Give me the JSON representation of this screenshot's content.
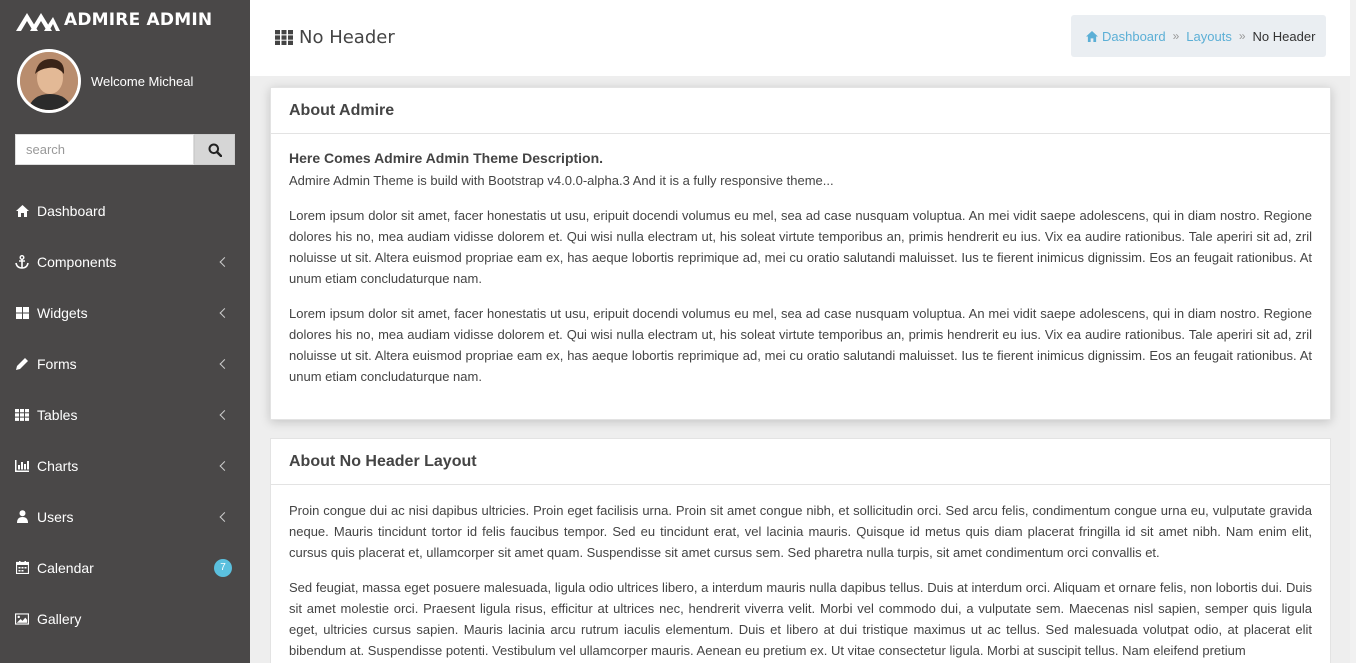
{
  "brand": {
    "name": "ADMIRE ADMIN"
  },
  "profile": {
    "welcome": "Welcome Micheal"
  },
  "search": {
    "placeholder": "search"
  },
  "nav": [
    {
      "label": "Dashboard",
      "icon": "home-icon",
      "submenu": false
    },
    {
      "label": "Components",
      "icon": "anchor-icon",
      "submenu": true
    },
    {
      "label": "Widgets",
      "icon": "th-large-icon",
      "submenu": true
    },
    {
      "label": "Forms",
      "icon": "pencil-icon",
      "submenu": true
    },
    {
      "label": "Tables",
      "icon": "table-icon",
      "submenu": true
    },
    {
      "label": "Charts",
      "icon": "bar-chart-icon",
      "submenu": true
    },
    {
      "label": "Users",
      "icon": "user-icon",
      "submenu": true
    },
    {
      "label": "Calendar",
      "icon": "calendar-icon",
      "submenu": false,
      "badge": "7"
    },
    {
      "label": "Gallery",
      "icon": "image-icon",
      "submenu": false
    }
  ],
  "header": {
    "title": "No Header",
    "breadcrumb": [
      "Dashboard",
      "Layouts",
      "No Header"
    ]
  },
  "card1": {
    "title": "About Admire",
    "subtitle": "Here Comes Admire Admin Theme Description.",
    "intro": "Admire Admin Theme is build with Bootstrap v4.0.0-alpha.3 And it is a fully responsive theme...",
    "para1": "Lorem ipsum dolor sit amet, facer honestatis ut usu, eripuit docendi volumus eu mel, sea ad case nusquam voluptua. An mei vidit saepe adolescens, qui in diam nostro. Regione dolores his no, mea audiam vidisse dolorem et. Qui wisi nulla electram ut, his soleat virtute temporibus an, primis hendrerit eu ius. Vix ea audire rationibus. Tale aperiri sit ad, zril noluisse ut sit. Altera euismod propriae eam ex, has aeque lobortis reprimique ad, mei cu oratio salutandi maluisset. Ius te fierent inimicus dignissim. Eos an feugait rationibus. At unum etiam concludaturque nam.",
    "para2": "Lorem ipsum dolor sit amet, facer honestatis ut usu, eripuit docendi volumus eu mel, sea ad case nusquam voluptua. An mei vidit saepe adolescens, qui in diam nostro. Regione dolores his no, mea audiam vidisse dolorem et. Qui wisi nulla electram ut, his soleat virtute temporibus an, primis hendrerit eu ius. Vix ea audire rationibus. Tale aperiri sit ad, zril noluisse ut sit. Altera euismod propriae eam ex, has aeque lobortis reprimique ad, mei cu oratio salutandi maluisset. Ius te fierent inimicus dignissim. Eos an feugait rationibus. At unum etiam concludaturque nam."
  },
  "card2": {
    "title": "About No Header Layout",
    "para1": "Proin congue dui ac nisi dapibus ultricies. Proin eget facilisis urna. Proin sit amet congue nibh, et sollicitudin orci. Sed arcu felis, condimentum congue urna eu, vulputate gravida neque. Mauris tincidunt tortor id felis faucibus tempor. Sed eu tincidunt erat, vel lacinia mauris. Quisque id metus quis diam placerat fringilla id sit amet nibh. Nam enim elit, cursus quis placerat et, ullamcorper sit amet quam. Suspendisse sit amet cursus sem. Sed pharetra nulla turpis, sit amet condimentum orci convallis et.",
    "para2": "Sed feugiat, massa eget posuere malesuada, ligula odio ultrices libero, a interdum mauris nulla dapibus tellus. Duis at interdum orci. Aliquam et ornare felis, non lobortis dui. Duis sit amet molestie orci. Praesent ligula risus, efficitur at ultrices nec, hendrerit viverra velit. Morbi vel commodo dui, a vulputate sem. Maecenas nisl sapien, semper quis ligula eget, ultricies cursus sapien. Mauris lacinia arcu rutrum iaculis elementum. Duis et libero at dui tristique maximus ut ac tellus. Sed malesuada volutpat odio, at placerat elit bibendum at. Suspendisse potenti. Vestibulum vel ullamcorper mauris. Aenean eu pretium ex. Ut vitae consectetur ligula. Morbi at suscipit tellus. Nam eleifend pretium"
  },
  "colors": {
    "sidebar": "#4a4848",
    "accent": "#5bc0de",
    "link": "#5bafd6"
  }
}
